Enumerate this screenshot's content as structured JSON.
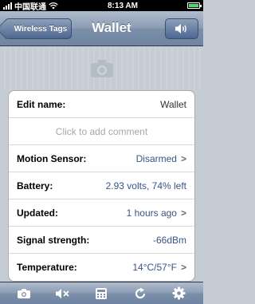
{
  "status": {
    "carrier": "中国联通",
    "time": "8:13 AM"
  },
  "nav": {
    "back_label": "Wireless Tags",
    "title": "Wallet",
    "speaker_icon": "speaker-icon"
  },
  "rows": {
    "edit_name": {
      "label": "Edit name:",
      "value": "Wallet"
    },
    "comment_placeholder": "Click to add comment",
    "motion": {
      "label": "Motion Sensor:",
      "value": "Disarmed"
    },
    "battery": {
      "label": "Battery:",
      "value": "2.93 volts, 74% left"
    },
    "updated": {
      "label": "Updated:",
      "value": "1 hours ago"
    },
    "signal": {
      "label": "Signal strength:",
      "value": "-66dBm"
    },
    "temperature": {
      "label": "Temperature:",
      "value": "14°C/57°F"
    }
  },
  "toolbar": {
    "icons": [
      "camera-icon",
      "mute-icon",
      "calculator-icon",
      "refresh-icon",
      "settings-icon"
    ]
  },
  "colors": {
    "value_blue": "#385487",
    "nav_gradient_mid": "#7c8fa9"
  }
}
